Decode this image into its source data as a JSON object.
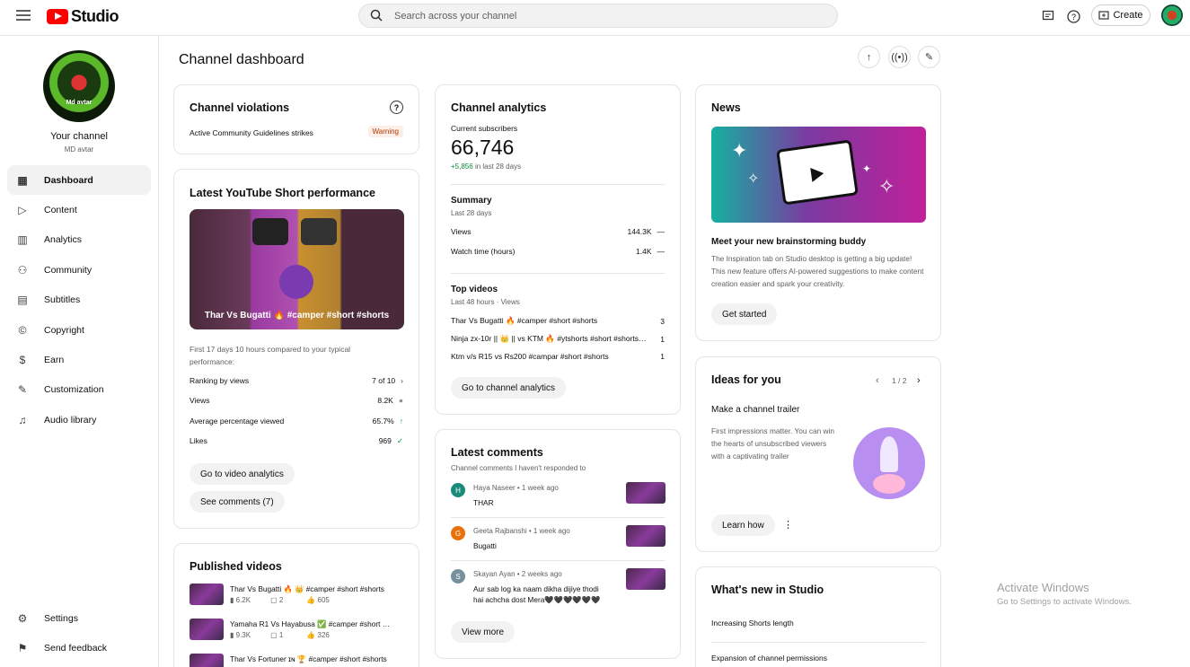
{
  "topbar": {
    "logo_text": "Studio",
    "search_placeholder": "Search across your channel",
    "create_label": "Create"
  },
  "sidebar": {
    "avatar_text": "Md avtar",
    "channel_title": "Your channel",
    "channel_name": "MD avtar",
    "items": [
      {
        "label": "Dashboard",
        "icon": "dashboard-icon",
        "glyph": "▦",
        "active": true
      },
      {
        "label": "Content",
        "icon": "content-icon",
        "glyph": "▷"
      },
      {
        "label": "Analytics",
        "icon": "analytics-icon",
        "glyph": "▥"
      },
      {
        "label": "Community",
        "icon": "community-icon",
        "glyph": "⚇"
      },
      {
        "label": "Subtitles",
        "icon": "subtitles-icon",
        "glyph": "▤"
      },
      {
        "label": "Copyright",
        "icon": "copyright-icon",
        "glyph": "©"
      },
      {
        "label": "Earn",
        "icon": "earn-icon",
        "glyph": "$"
      },
      {
        "label": "Customization",
        "icon": "customization-icon",
        "glyph": "✎"
      },
      {
        "label": "Audio library",
        "icon": "audio-library-icon",
        "glyph": "♫"
      }
    ],
    "bottom": [
      {
        "label": "Settings",
        "icon": "settings-icon",
        "glyph": "⚙"
      },
      {
        "label": "Send feedback",
        "icon": "feedback-icon",
        "glyph": "⚑"
      }
    ]
  },
  "main": {
    "title": "Channel dashboard"
  },
  "violations": {
    "title": "Channel violations",
    "help_glyph": "?",
    "label": "Active Community Guidelines strikes",
    "badge": "Warning"
  },
  "short_perf": {
    "title": "Latest YouTube Short performance",
    "thumb_caption": "Thar Vs Bugatti 🔥 #camper #short #shorts",
    "compare_note": "First 17 days 10 hours compared to your typical performance:",
    "rows": [
      {
        "label": "Ranking by views",
        "value": "7 of 10",
        "glyph": "›"
      },
      {
        "label": "Views",
        "value": "8.2K",
        "glyph": "●"
      },
      {
        "label": "Average percentage viewed",
        "value": "65.7%",
        "glyph": "↑"
      },
      {
        "label": "Likes",
        "value": "969",
        "glyph": "✓"
      }
    ],
    "btn_analytics": "Go to video analytics",
    "btn_comments": "See comments (7)"
  },
  "published": {
    "title": "Published videos",
    "videos": [
      {
        "title": "Thar Vs Bugatti 🔥 👑 #camper #short #shorts",
        "views": "6.2K",
        "comments": "2",
        "likes": "605"
      },
      {
        "title": "Yamaha R1 Vs Hayabusa ✅ #camper #short …",
        "views": "9.3K",
        "comments": "1",
        "likes": "326"
      },
      {
        "title": "Thar Vs Fortuner ɪɴ 🏆 #camper #short #shorts",
        "views": "",
        "comments": "",
        "likes": ""
      }
    ]
  },
  "analytics": {
    "title": "Channel analytics",
    "subs_label": "Current subscribers",
    "subs_value": "66,746",
    "subs_delta": "+5,856",
    "subs_delta_suffix": "in last 28 days",
    "summary_title": "Summary",
    "summary_period": "Last 28 days",
    "summary_rows": [
      {
        "label": "Views",
        "value": "144.3K",
        "glyph": "—"
      },
      {
        "label": "Watch time (hours)",
        "value": "1.4K",
        "glyph": "—"
      }
    ],
    "top_title": "Top videos",
    "top_period": "Last 48 hours · Views",
    "top_rows": [
      {
        "label": "Thar Vs Bugatti 🔥 #camper #short #shorts",
        "value": "3"
      },
      {
        "label": "Ninja zx-10r || 👑 || vs KTM 🔥 #ytshorts #short #shorts…",
        "value": "1"
      },
      {
        "label": "Ktm v/s R15 vs Rs200 #campar #short #shorts",
        "value": "1"
      }
    ],
    "btn": "Go to channel analytics"
  },
  "comments": {
    "title": "Latest comments",
    "subtitle": "Channel comments I haven't responded to",
    "items": [
      {
        "initial": "H",
        "color": "#1a8a7a",
        "author": "Haya Naseer",
        "time": "1 week ago",
        "text": "THAR"
      },
      {
        "initial": "G",
        "color": "#e8710a",
        "author": "Geeta Rajbanshi",
        "time": "1 week ago",
        "text": "Bugatti"
      },
      {
        "initial": "S",
        "color": "#78909c",
        "author": "Skayan Ayan",
        "time": "2 weeks ago",
        "text": "Aur sab log ka naam dikha dijiye thodi hai achcha dost Mera🖤🖤🖤🖤🖤🖤"
      }
    ],
    "btn": "View more"
  },
  "news": {
    "title": "News",
    "headline": "Meet your new brainstorming buddy",
    "body": "The Inspiration tab on Studio desktop is getting a big update! This new feature offers AI-powered suggestions to make content creation easier and spark your creativity.",
    "btn": "Get started"
  },
  "ideas": {
    "title": "Ideas for you",
    "pager": "1 / 2",
    "headline": "Make a channel trailer",
    "body": "First impressions matter. You can win the hearts of unsubscribed viewers with a captivating trailer",
    "btn": "Learn how",
    "more_glyph": "⋮"
  },
  "whats_new": {
    "title": "What's new in Studio",
    "items": [
      "Increasing Shorts length",
      "Expansion of channel permissions"
    ]
  },
  "watermark": {
    "line1": "Activate Windows",
    "line2": "Go to Settings to activate Windows."
  }
}
